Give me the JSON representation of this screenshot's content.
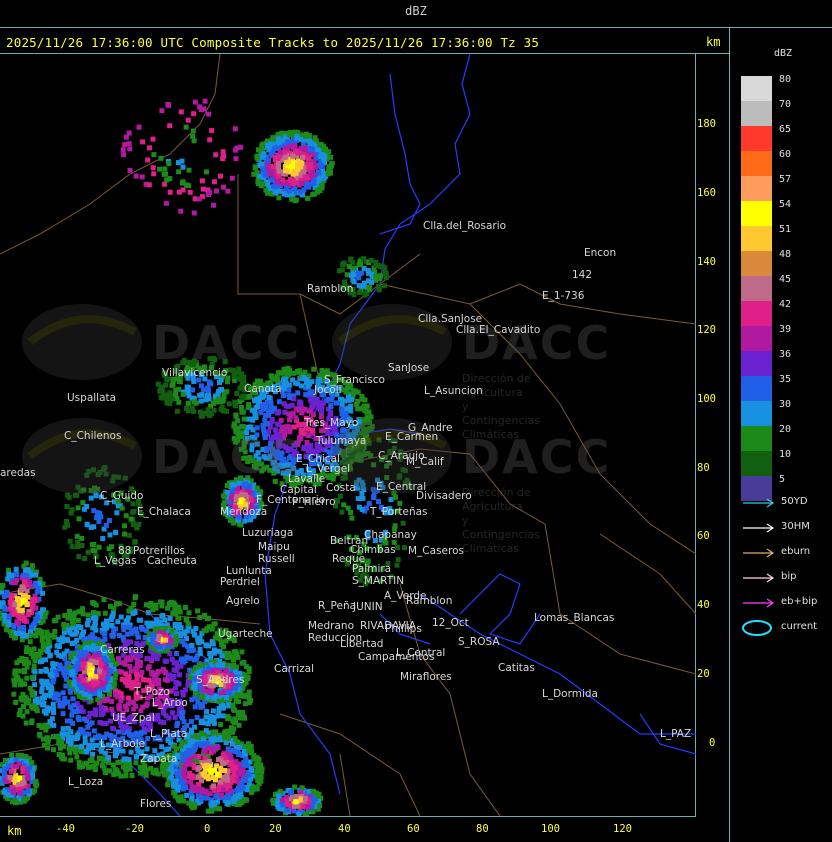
{
  "window_title": "dBZ",
  "header": "2025/11/26 17:36:00 UTC Composite Tracks to 2025/11/26 17:36:00 Tz 35",
  "axis_unit": "km",
  "y_ticks": [
    "180",
    "160",
    "140",
    "120",
    "100",
    "80",
    "60",
    "40",
    "20",
    "0"
  ],
  "x_ticks": [
    "-40",
    "-20",
    "0",
    "20",
    "40",
    "60",
    "80",
    "100",
    "120"
  ],
  "legend": {
    "title": "dBZ",
    "levels": [
      {
        "label": "80",
        "color": "#d8d8d8"
      },
      {
        "label": "70",
        "color": "#bcbcbc"
      },
      {
        "label": "65",
        "color": "#ff3a2a"
      },
      {
        "label": "60",
        "color": "#ff6a18"
      },
      {
        "label": "57",
        "color": "#ff9b5c"
      },
      {
        "label": "54",
        "color": "#ffff00"
      },
      {
        "label": "51",
        "color": "#ffc830"
      },
      {
        "label": "48",
        "color": "#d88a3a"
      },
      {
        "label": "45",
        "color": "#c06a8a"
      },
      {
        "label": "42",
        "color": "#e0208a"
      },
      {
        "label": "39",
        "color": "#b01aa0"
      },
      {
        "label": "36",
        "color": "#6a22d0"
      },
      {
        "label": "35",
        "color": "#2060e8"
      },
      {
        "label": "30",
        "color": "#1890e0"
      },
      {
        "label": "20",
        "color": "#1c8a18"
      },
      {
        "label": "10",
        "color": "#106010"
      },
      {
        "label": "5",
        "color": "#483c98"
      }
    ],
    "tracks": [
      {
        "label": "50YD",
        "color": "#30d0e0"
      },
      {
        "label": "30HM",
        "color": "#ffffff"
      },
      {
        "label": "eburn",
        "color": "#e0b070"
      },
      {
        "label": "bip",
        "color": "#ffd8e8"
      },
      {
        "label": "eb+bip",
        "color": "#ff40ff"
      },
      {
        "label": "current",
        "color": "#20e0ff"
      }
    ]
  },
  "watermark": {
    "word": "DACC",
    "line1": "Dirección de Agricultura",
    "line2": "y Contingencias Climáticas"
  },
  "places": [
    {
      "name": "Clla.del_Rosario"
    },
    {
      "name": "Encon"
    },
    {
      "name": "142"
    },
    {
      "name": "E_1-736"
    },
    {
      "name": "Ramblon"
    },
    {
      "name": "Clla.SanJose"
    },
    {
      "name": "Clla.El_Cavadito"
    },
    {
      "name": "Villavicencio"
    },
    {
      "name": "Canota"
    },
    {
      "name": "S_Francisco"
    },
    {
      "name": "SanJose"
    },
    {
      "name": "Uspallata"
    },
    {
      "name": "Jocoli"
    },
    {
      "name": "L_Asuncion"
    },
    {
      "name": "C_Chilenos"
    },
    {
      "name": "Tres_Mayo"
    },
    {
      "name": "G_Andre"
    },
    {
      "name": "E_Carmen"
    },
    {
      "name": "Tulumaya"
    },
    {
      "name": "C_Araujo"
    },
    {
      "name": "M_Calif"
    },
    {
      "name": "E_Chical"
    },
    {
      "name": "L_Vergel"
    },
    {
      "name": "aredas"
    },
    {
      "name": "Lavalle"
    },
    {
      "name": "Costa"
    },
    {
      "name": "Capital"
    },
    {
      "name": "F_Centenario"
    },
    {
      "name": "E_Central"
    },
    {
      "name": "Divisadero"
    },
    {
      "name": "C_Guido"
    },
    {
      "name": "P_Hierro"
    },
    {
      "name": "Mendoza"
    },
    {
      "name": "E_Chalaca"
    },
    {
      "name": "T_Porteñas"
    },
    {
      "name": "Luzuriaga"
    },
    {
      "name": "Beltran"
    },
    {
      "name": "Chapanay"
    },
    {
      "name": "Maipu"
    },
    {
      "name": "Chimbas"
    },
    {
      "name": "M_Caseros"
    },
    {
      "name": "88"
    },
    {
      "name": "Potrerillos"
    },
    {
      "name": "Russell"
    },
    {
      "name": "L_Vegas"
    },
    {
      "name": "Cacheuta"
    },
    {
      "name": "Lunlunta"
    },
    {
      "name": "Reque"
    },
    {
      "name": "Palmira"
    },
    {
      "name": "Perdriel"
    },
    {
      "name": "S_MARTIN"
    },
    {
      "name": "A_Verde"
    },
    {
      "name": "Agrelo"
    },
    {
      "name": "R_Peña"
    },
    {
      "name": "JUNIN"
    },
    {
      "name": "Ramblon"
    },
    {
      "name": "Ugarteche"
    },
    {
      "name": "Medrano"
    },
    {
      "name": "RIVADAVIA"
    },
    {
      "name": "Phillips"
    },
    {
      "name": "Lomas_Blancas"
    },
    {
      "name": "Reduccion"
    },
    {
      "name": "12_Oct"
    },
    {
      "name": "S_ROSA"
    },
    {
      "name": "Libertad"
    },
    {
      "name": "Campamentos"
    },
    {
      "name": "L_Central"
    },
    {
      "name": "Carrizal"
    },
    {
      "name": "Catitas"
    },
    {
      "name": "Miraflores"
    },
    {
      "name": "Carreras"
    },
    {
      "name": "S_Andres"
    },
    {
      "name": "L_Dormida"
    },
    {
      "name": "L_Arbo"
    },
    {
      "name": "T_Pozo"
    },
    {
      "name": "UE_Zpal"
    },
    {
      "name": "L_PAZ"
    },
    {
      "name": "L_Arbole"
    },
    {
      "name": "L_Plata"
    },
    {
      "name": "Zapata"
    },
    {
      "name": "L_Loza"
    },
    {
      "name": "Flores"
    }
  ]
}
